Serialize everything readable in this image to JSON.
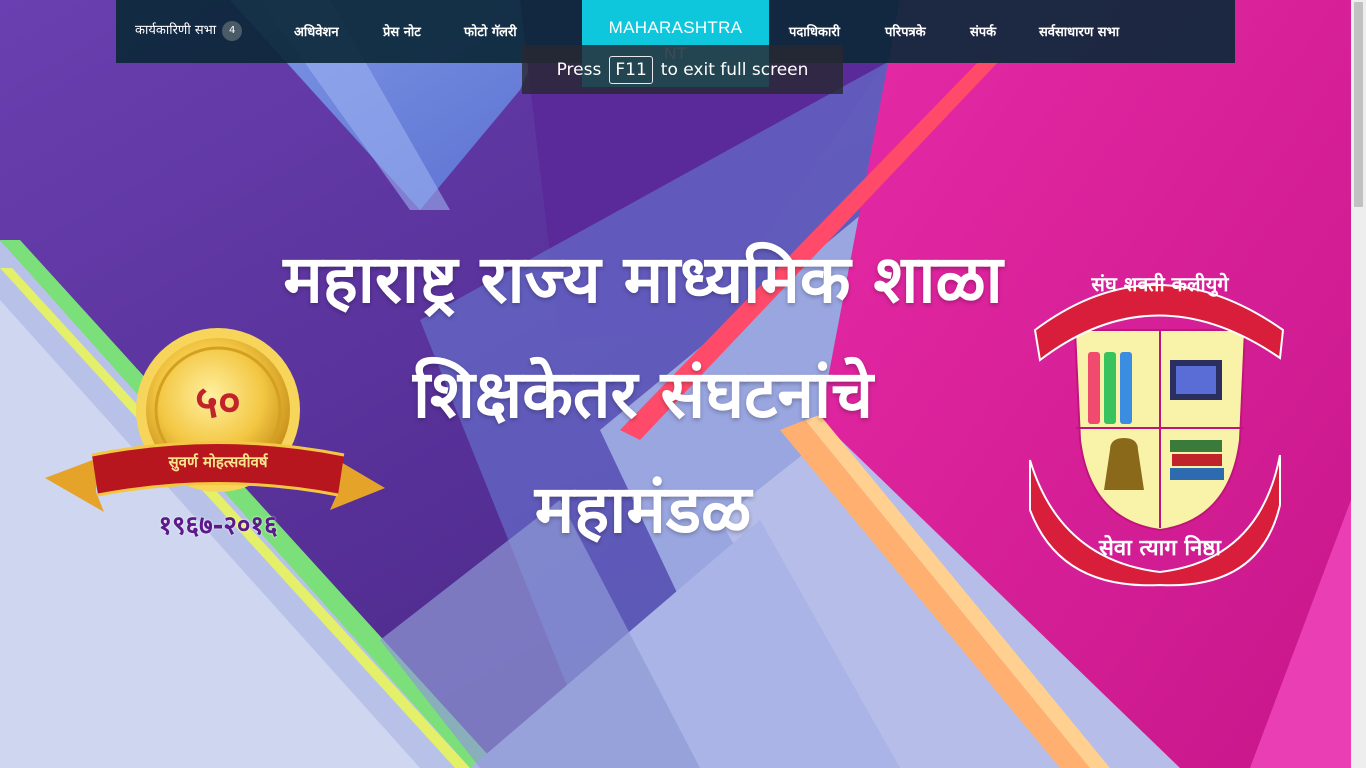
{
  "nav": {
    "items_left": [
      {
        "label": "कार्यकारिणी सभा",
        "badge": "4"
      },
      {
        "label": "अधिवेशन"
      },
      {
        "label": "प्रेस नोट"
      },
      {
        "label": "फोटो गॅलरी"
      }
    ],
    "brand": {
      "line1": "MAHARASHTRA",
      "line2": "NT"
    },
    "items_right": [
      {
        "label": "पदाधिकारी"
      },
      {
        "label": "परिपत्रके"
      },
      {
        "label": "संपर्क"
      },
      {
        "label": "सर्वसाधारण सभा"
      }
    ]
  },
  "fullscreen_notice": {
    "press": "Press",
    "key": "F11",
    "rest": "to exit full screen"
  },
  "hero": {
    "title_lines": [
      "महाराष्ट्र राज्य माध्यमिक शाळा",
      "शिक्षकेतर संघटनांचे",
      "महामंडळ"
    ],
    "medal": {
      "number": "५०",
      "ribbon": "सुवर्ण मोहत्सवीवर्ष",
      "years": "१९६७-२०१६"
    },
    "emblem": {
      "top_banner": "संघ शक्ती कलीयुगे",
      "bottom_banner": "सेवा त्याग निष्ठा"
    }
  },
  "colors": {
    "nav_bg": "#0c283a",
    "brand_bg": "#0fc7dd",
    "gold": "#e8b733",
    "emblem_red": "#d81e3a"
  }
}
